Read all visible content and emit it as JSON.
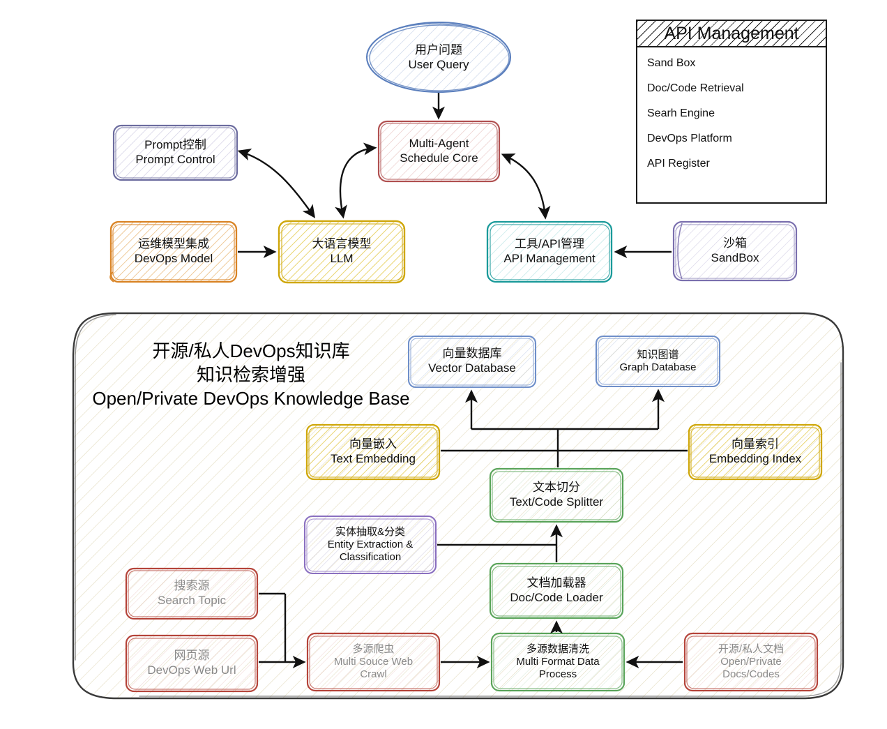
{
  "diagram": {
    "title_cn_1": "开源/私人DevOps知识库",
    "title_cn_2": "知识检索增强",
    "title_en": "Open/Private DevOps Knowledge Base"
  },
  "api_panel": {
    "header": "API Management",
    "items": [
      "Sand Box",
      "Doc/Code Retrieval",
      "Searh Engine",
      "DevOps Platform",
      "API  Register"
    ]
  },
  "nodes": {
    "user_query": {
      "cn": "用户问题",
      "en": "User Query"
    },
    "schedule_core": {
      "cn": "Multi-Agent",
      "en": "Schedule Core"
    },
    "prompt_control": {
      "cn": "Prompt控制",
      "en": "Prompt Control"
    },
    "devops_model": {
      "cn": "运维模型集成",
      "en": "DevOps Model"
    },
    "llm": {
      "cn": "大语言模型",
      "en": "LLM"
    },
    "api_management": {
      "cn": "工具/API管理",
      "en": "API Management"
    },
    "sandbox": {
      "cn": "沙箱",
      "en": "SandBox"
    },
    "vector_database": {
      "cn": "向量数据库",
      "en": "Vector Database"
    },
    "graph_database": {
      "cn": "知识图谱",
      "en": "Graph Database"
    },
    "text_embedding": {
      "cn": "向量嵌入",
      "en": "Text Embedding"
    },
    "embedding_index": {
      "cn": "向量索引",
      "en": "Embedding Index"
    },
    "text_splitter": {
      "cn": "文本切分",
      "en": "Text/Code Splitter"
    },
    "entity_extraction": {
      "cn": "实体抽取&分类",
      "en": "Entity Extraction &",
      "en2": "Classification"
    },
    "doc_loader": {
      "cn": "文档加载器",
      "en": "Doc/Code Loader"
    },
    "search_topic": {
      "cn": "搜索源",
      "en": "Search Topic"
    },
    "web_url": {
      "cn": "网页源",
      "en": "DevOps Web Url"
    },
    "web_crawl": {
      "cn": "多源爬虫",
      "en": "Multi Souce Web",
      "en2": "Crawl"
    },
    "data_process": {
      "cn": "多源数据清洗",
      "en": "Multi Format Data",
      "en2": "Process"
    },
    "docs_codes": {
      "cn": "开源/私人文档",
      "en": "Open/Private",
      "en2": "Docs/Codes"
    }
  },
  "colors": {
    "blue": "#5b7fbd",
    "red": "#b05050",
    "purple": "#6b5b9a",
    "orange": "#d98324",
    "yellow": "#d4b106",
    "teal": "#1a9a9a",
    "lavender": "#7a6fae",
    "green": "#5aa45a",
    "pink_red": "#b5443a",
    "container_border": "#3a3a3a",
    "edge": "#111111",
    "gray_text": "#8a8a8a"
  }
}
